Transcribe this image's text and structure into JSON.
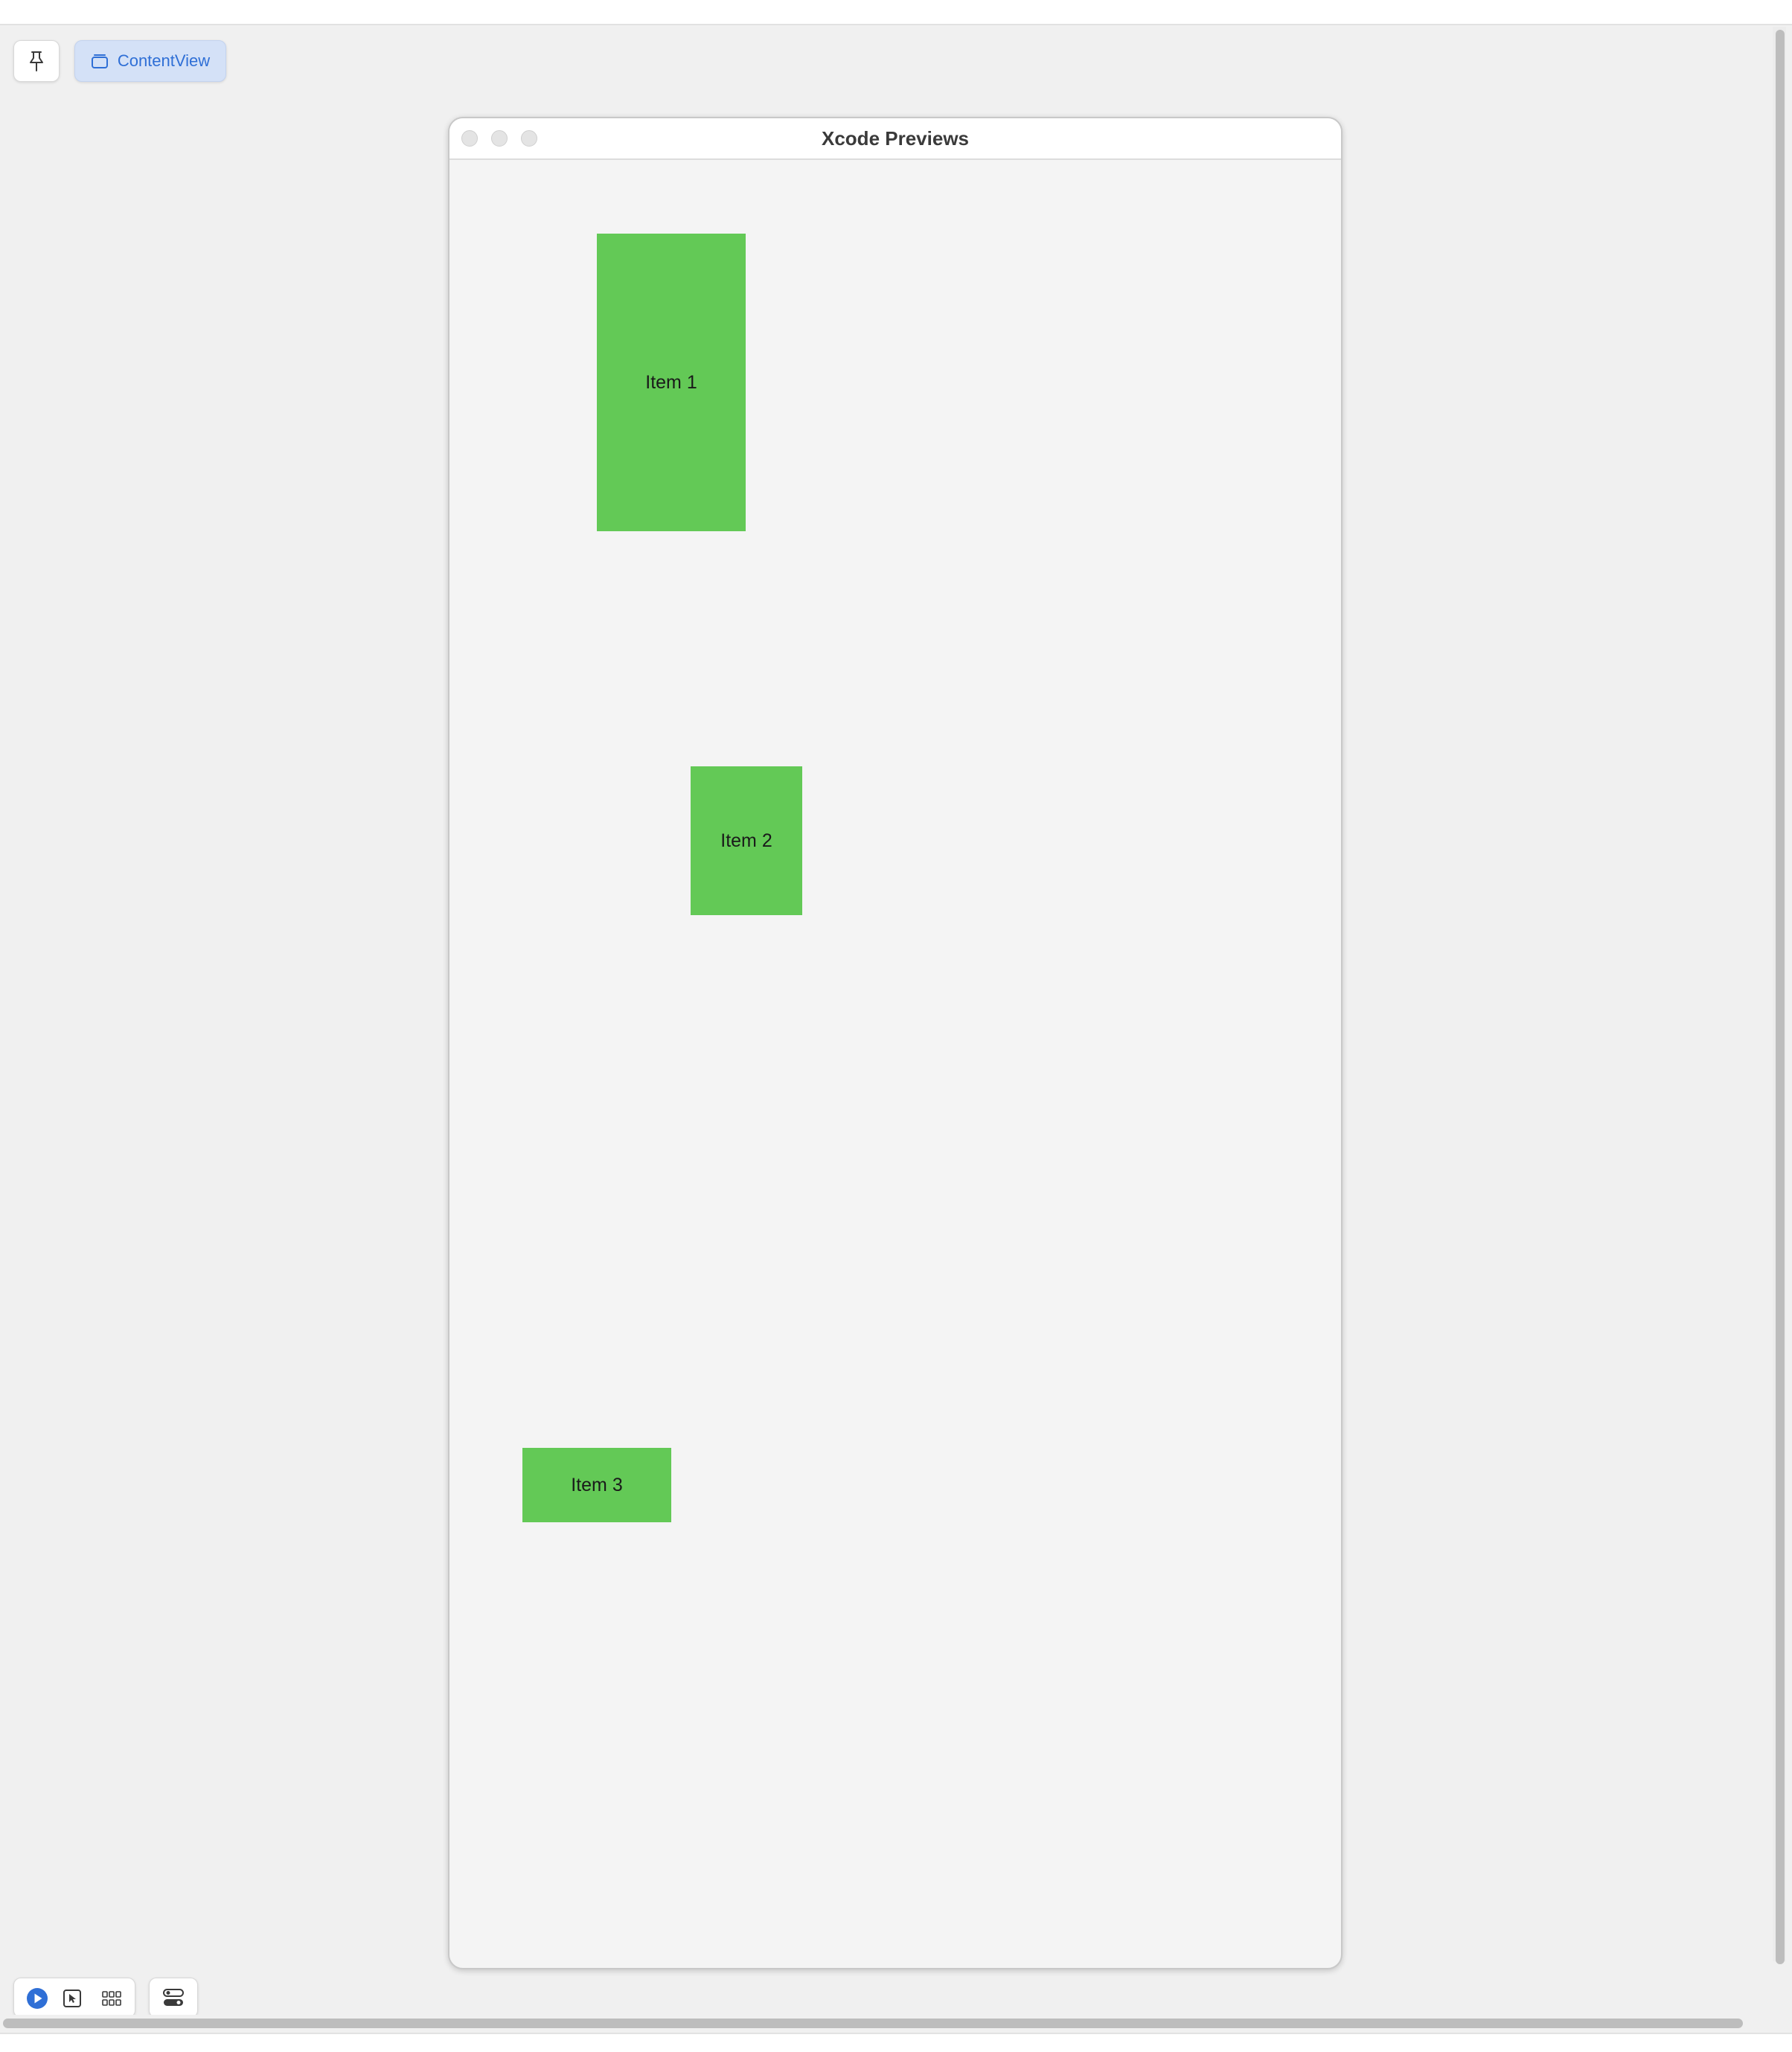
{
  "toolbar": {
    "pin_icon": "pin-icon",
    "content_view_label": "ContentView",
    "content_view_icon": "preview-stack-icon",
    "accent_color": "#2f6fd6"
  },
  "preview_window": {
    "title": "Xcode Previews",
    "items": [
      {
        "label": "Item 1"
      },
      {
        "label": "Item 2"
      },
      {
        "label": "Item 3"
      }
    ],
    "item_color": "#63c956"
  },
  "bottom_toolbar": {
    "icons": [
      "live-preview-icon",
      "selectable-mode-icon",
      "variants-grid-icon",
      "device-settings-icon"
    ]
  }
}
